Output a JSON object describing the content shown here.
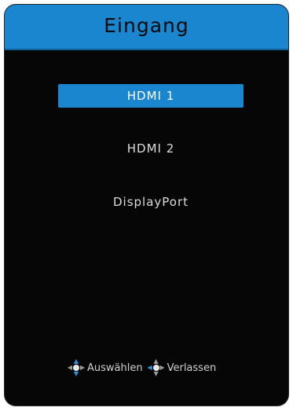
{
  "osd": {
    "title": "Eingang",
    "items": [
      {
        "label": "HDMI 1",
        "selected": true
      },
      {
        "label": "HDMI 2",
        "selected": false
      },
      {
        "label": "DisplayPort",
        "selected": false
      }
    ],
    "footer": {
      "select_label": "Auswählen",
      "exit_label": "Verlassen"
    },
    "colors": {
      "accent": "#1a86cf",
      "background": "#060606",
      "text": "#dcdcdc"
    },
    "icons": {
      "select": "joystick-up-down-icon",
      "exit": "joystick-left-icon"
    }
  }
}
